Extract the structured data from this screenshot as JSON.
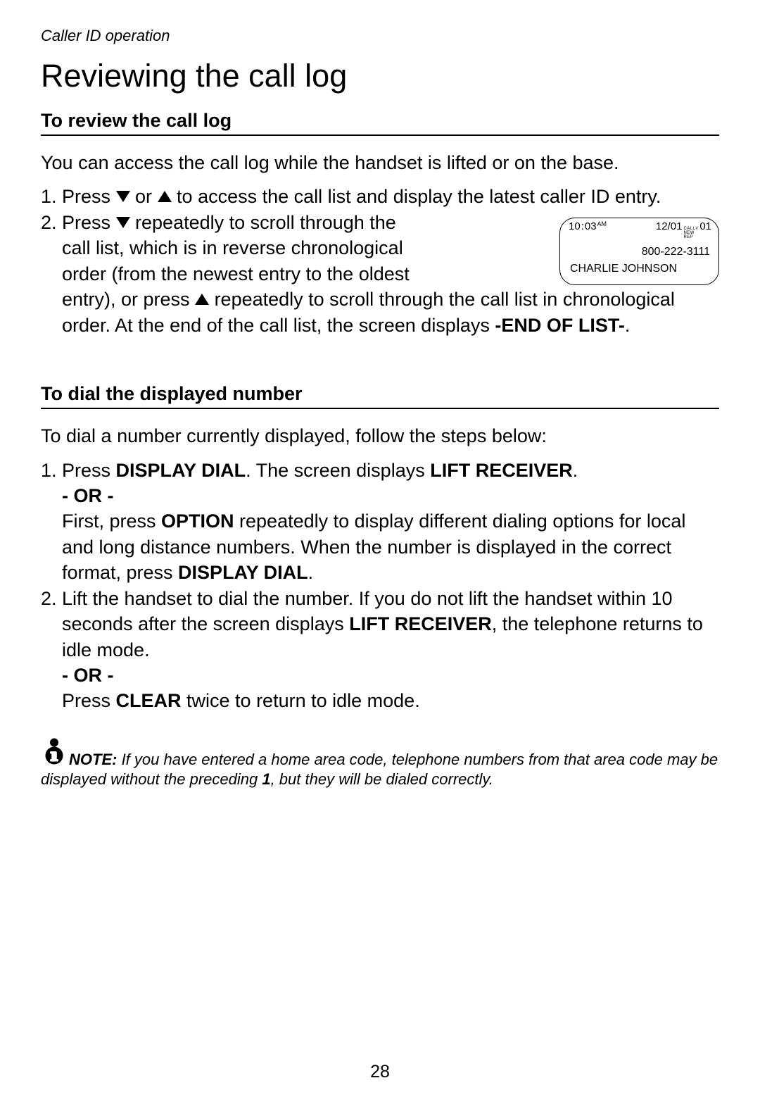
{
  "breadcrumb": "Caller ID operation",
  "page_title": "Reviewing the call log",
  "section1": {
    "heading": "To review the call log",
    "intro": "You can access the call log while the handset is lifted or on the base.",
    "items": {
      "num1": "1.",
      "body1_a": "Press ",
      "body1_b": " or ",
      "body1_c": " to access the call list and display the latest caller ID entry.",
      "num2": "2.",
      "body2_a": "Press ",
      "body2_b_narrow": " repeatedly to scroll through the call list, which is in reverse chronological order (from the newest entry to the oldest ",
      "body2_c": "entry), or press ",
      "body2_d": " repeatedly to scroll through the call list in chronological order. At the end of the call list, the screen displays ",
      "body2_end": "-END OF LIST-",
      "body2_period": "."
    }
  },
  "display": {
    "time_h": "10",
    "time_colon": ":",
    "time_m": "03",
    "ampm": "AM",
    "date": "12/01",
    "flag1": "CALL#",
    "flag2": "NEW",
    "flag3": "REP",
    "callnum": "01",
    "phone": "800-222-3111",
    "name": "CHARLIE JOHNSON"
  },
  "section2": {
    "heading": "To dial the displayed number",
    "intro": "To dial a number currently displayed, follow the steps below:",
    "items": {
      "num1": "1.",
      "b1_a": "Press ",
      "b1_dd": "DISPLAY DIAL",
      "b1_b": ". The screen displays ",
      "b1_lr": "LIFT RECEIVER",
      "b1_c": ".",
      "or1": "- OR -",
      "b1_d": "First, press ",
      "b1_opt": "OPTION",
      "b1_e": " repeatedly to display different dialing options for local and long distance numbers. When the number is displayed in the correct format, press ",
      "b1_dd2": "DISPLAY DIAL",
      "b1_f": ".",
      "num2": "2.",
      "b2_a": "Lift the handset to dial the number. If you do not lift the handset within 10 seconds after the screen displays ",
      "b2_lr": "LIFT RECEIVER",
      "b2_b": ", the telephone returns to idle mode.",
      "or2": "- OR -",
      "b2_c": "Press ",
      "b2_clr": "CLEAR",
      "b2_d": " twice to return to idle mode."
    }
  },
  "note": {
    "label": "NOTE:",
    "text_a": " If you have entered a home area code, telephone numbers from that area code may be displayed without the preceding ",
    "bold1": "1",
    "text_b": ", but they will be dialed correctly."
  },
  "page_number": "28"
}
